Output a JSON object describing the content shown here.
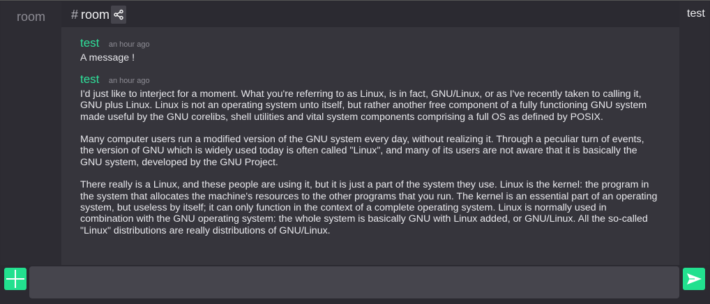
{
  "sidebar": {
    "room_label": "room"
  },
  "header": {
    "hash": "#",
    "title": "room",
    "share_icon": "share-icon"
  },
  "user_panel": {
    "username": "test"
  },
  "messages": [
    {
      "author": "test",
      "time": "an hour ago",
      "paragraphs": [
        "A message !"
      ]
    },
    {
      "author": "test",
      "time": "an hour ago",
      "paragraphs": [
        "I'd just like to interject for a moment. What you're referring to as Linux, is in fact, GNU/Linux, or as I've recently taken to calling it, GNU plus Linux. Linux is not an operating system unto itself, but rather another free component of a fully functioning GNU system made useful by the GNU corelibs, shell utilities and vital system components comprising a full OS as defined by POSIX.",
        "Many computer users run a modified version of the GNU system every day, without realizing it. Through a peculiar turn of events, the version of GNU which is widely used today is often called \"Linux\", and many of its users are not aware that it is basically the GNU system, developed by the GNU Project.",
        "There really is a Linux, and these people are using it, but it is just a part of the system they use. Linux is the kernel: the program in the system that allocates the machine's resources to the other programs that you run. The kernel is an essential part of an operating system, but useless by itself; it can only function in the context of a complete operating system. Linux is normally used in combination with the GNU operating system: the whole system is basically GNU with Linux added, or GNU/Linux. All the so-called \"Linux\" distributions are really distributions of GNU/Linux."
      ]
    }
  ],
  "composer": {
    "value": "",
    "placeholder": "",
    "add_icon": "plus-icon",
    "send_icon": "send-icon"
  },
  "colors": {
    "accent": "#22e08f",
    "author": "#2fe09a",
    "background": "#36353c"
  }
}
